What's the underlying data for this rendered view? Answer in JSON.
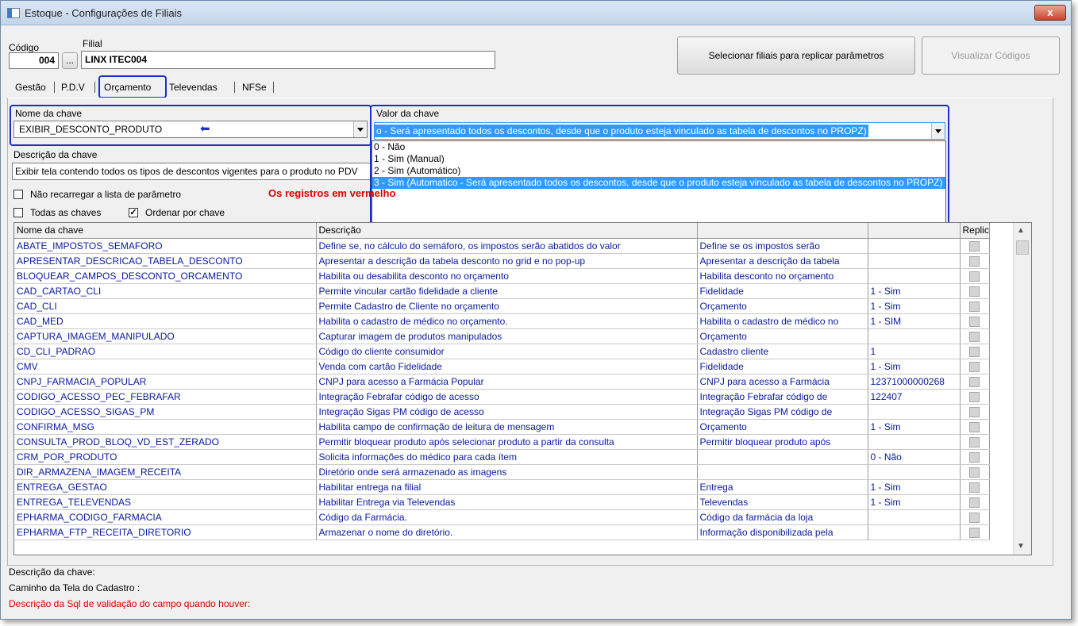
{
  "window": {
    "title": "Estoque - Configurações de Filiais",
    "close_label": "x"
  },
  "header": {
    "codigo_label": "Código",
    "codigo_value": "004",
    "browse_label": "...",
    "filial_label": "Filial",
    "filial_value": "LINX ITEC004",
    "replicate_button": "Selecionar filiais para replicar parâmetros",
    "view_codes_button": "Visualizar Códigos"
  },
  "tabs": [
    "Gestão",
    "P.D.V",
    "Orçamento",
    "Televendas",
    "NFSe"
  ],
  "active_tab": "Orçamento",
  "key_name": {
    "label": "Nome da chave",
    "value": "EXIBIR_DESCONTO_PRODUTO"
  },
  "key_value": {
    "label": "Valor da chave",
    "value": "o - Será apresentado todos os descontos, desde que o produto esteja vinculado as tabela de descontos no PROPZ)",
    "options": [
      "0 - Não",
      "1 - Sim (Manual)",
      "2 - Sim (Automático)",
      "3 - Sim (Automatico - Será apresentado todos os descontos, desde que o produto esteja vinculado as tabela de descontos no PROPZ)"
    ],
    "selected_index": 3
  },
  "key_description": {
    "label": "Descrição da chave",
    "value": "Exibir tela contendo todos os tipos de descontos vigentes para o produto no PDV"
  },
  "options": {
    "no_reload_label": "Não recarregar a lista de parâmetro",
    "no_reload_checked": false,
    "warning_text": "Os registros em vermelho",
    "all_keys_label": "Todas as chaves",
    "all_keys_checked": false,
    "order_by_key_label": "Ordenar por chave",
    "order_by_key_checked": true
  },
  "grid": {
    "columns": [
      "Nome da chave",
      "Descrição",
      "",
      "",
      "Replic"
    ],
    "rows": [
      [
        "ABATE_IMPOSTOS_SEMAFORO",
        "Define se, no cálculo do semáforo, os impostos serão abatidos do valor",
        "Define se os impostos serão",
        ""
      ],
      [
        "APRESENTAR_DESCRICAO_TABELA_DESCONTO",
        "Apresentar a descrição da tabela desconto no grid e no pop-up",
        "Apresentar a descrição da tabela",
        ""
      ],
      [
        "BLOQUEAR_CAMPOS_DESCONTO_ORCAMENTO",
        "Habilita ou desabilita desconto no orçamento",
        "Habilita desconto no orçamento",
        ""
      ],
      [
        "CAD_CARTAO_CLI",
        "Permite vincular cartão fidelidade a cliente",
        "Fidelidade",
        "1 - Sim"
      ],
      [
        "CAD_CLI",
        "Permite Cadastro de Cliente no orçamento",
        "Orçamento",
        "1 - Sim"
      ],
      [
        "CAD_MED",
        "Habilita o cadastro de médico no orçamento.",
        "Habilita o cadastro de médico no",
        "1 - SIM"
      ],
      [
        "CAPTURA_IMAGEM_MANIPULADO",
        "Capturar imagem de produtos manipulados",
        "Orçamento",
        ""
      ],
      [
        "CD_CLI_PADRAO",
        "Código do cliente consumidor",
        "Cadastro cliente",
        "1"
      ],
      [
        "CMV",
        "Venda com cartão Fidelidade",
        "Fidelidade",
        "1 - Sim"
      ],
      [
        "CNPJ_FARMACIA_POPULAR",
        "CNPJ para acesso a Farmácia Popular",
        "CNPJ para acesso a Farmácia",
        "12371000000268"
      ],
      [
        "CODIGO_ACESSO_PEC_FEBRAFAR",
        "Integração Febrafar código de acesso",
        "Integração Febrafar código de",
        "122407"
      ],
      [
        "CODIGO_ACESSO_SIGAS_PM",
        "Integração Sigas PM código de acesso",
        "Integração Sigas PM código de",
        ""
      ],
      [
        "CONFIRMA_MSG",
        "Habilita campo de confirmação de leitura de mensagem",
        "Orçamento",
        "1 - Sim"
      ],
      [
        "CONSULTA_PROD_BLOQ_VD_EST_ZERADO",
        "Permitir bloquear produto após selecionar produto a partir da consulta",
        "Permitir bloquear produto após",
        ""
      ],
      [
        "CRM_POR_PRODUTO",
        "Solicita informações do médico para cada ítem",
        "",
        "0 - Não"
      ],
      [
        "DIR_ARMAZENA_IMAGEM_RECEITA",
        "Diretório onde será armazenado as imagens",
        "",
        ""
      ],
      [
        "ENTREGA_GESTAO",
        "Habilitar entrega na filial",
        "Entrega",
        "1 - Sim"
      ],
      [
        "ENTREGA_TELEVENDAS",
        "Habilitar Entrega via Televendas",
        "Televendas",
        "1 - Sim"
      ],
      [
        "EPHARMA_CODIGO_FARMACIA",
        "Código da Farmácia.",
        "Código da farmácia da loja",
        ""
      ],
      [
        "EPHARMA_FTP_RECEITA_DIRETORIO",
        "Armazenar o nome do diretório.",
        "Informação disponibilizada pela",
        ""
      ]
    ]
  },
  "footer": {
    "key_desc_label": "Descrição da chave:",
    "path_label": "Caminho da Tela do Cadastro :",
    "sql_label": "Descrição da Sql de validação do campo quando houver:"
  },
  "colors": {
    "accent_blue": "#1a2fc8",
    "row_text": "#0a1a9c",
    "selection": "#3399ff",
    "warning_red": "#e00000"
  }
}
